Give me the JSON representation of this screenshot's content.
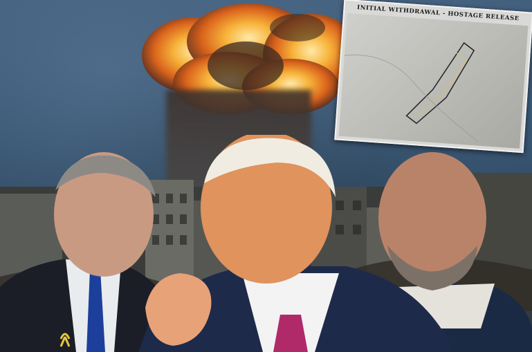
{
  "image": {
    "subjects": [
      "left-man",
      "center-man",
      "right-man"
    ],
    "map_card": {
      "title": "INITIAL WITHDRAWAL - HOSTAGE RELEASE"
    },
    "colors": {
      "sky": "#355270",
      "fire": "#f2a22a",
      "smoke": "#4a3b33",
      "suit": "#1d2a4a",
      "tie_left": "#1c3f9c",
      "tie_center": "#b02a6a"
    }
  }
}
